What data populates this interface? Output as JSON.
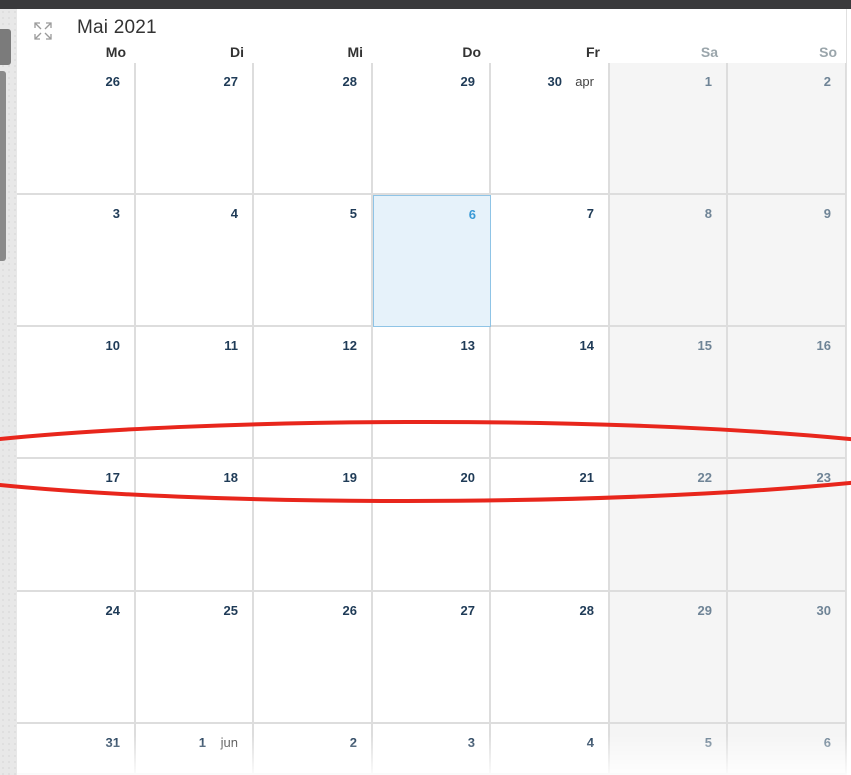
{
  "calendar": {
    "title": "Mai 2021",
    "weekdays": [
      "Mo",
      "Di",
      "Mi",
      "Do",
      "Fr",
      "Sa",
      "So"
    ],
    "weeks": [
      [
        {
          "day": "26",
          "label": ""
        },
        {
          "day": "27",
          "label": ""
        },
        {
          "day": "28",
          "label": ""
        },
        {
          "day": "29",
          "label": ""
        },
        {
          "day": "30",
          "label": "apr"
        },
        {
          "day": "1",
          "label": ""
        },
        {
          "day": "2",
          "label": ""
        }
      ],
      [
        {
          "day": "3",
          "label": ""
        },
        {
          "day": "4",
          "label": ""
        },
        {
          "day": "5",
          "label": ""
        },
        {
          "day": "6",
          "label": ""
        },
        {
          "day": "7",
          "label": ""
        },
        {
          "day": "8",
          "label": ""
        },
        {
          "day": "9",
          "label": ""
        }
      ],
      [
        {
          "day": "10",
          "label": ""
        },
        {
          "day": "11",
          "label": ""
        },
        {
          "day": "12",
          "label": ""
        },
        {
          "day": "13",
          "label": ""
        },
        {
          "day": "14",
          "label": ""
        },
        {
          "day": "15",
          "label": ""
        },
        {
          "day": "16",
          "label": ""
        }
      ],
      [
        {
          "day": "17",
          "label": ""
        },
        {
          "day": "18",
          "label": ""
        },
        {
          "day": "19",
          "label": ""
        },
        {
          "day": "20",
          "label": ""
        },
        {
          "day": "21",
          "label": ""
        },
        {
          "day": "22",
          "label": ""
        },
        {
          "day": "23",
          "label": ""
        }
      ],
      [
        {
          "day": "24",
          "label": ""
        },
        {
          "day": "25",
          "label": ""
        },
        {
          "day": "26",
          "label": ""
        },
        {
          "day": "27",
          "label": ""
        },
        {
          "day": "28",
          "label": ""
        },
        {
          "day": "29",
          "label": ""
        },
        {
          "day": "30",
          "label": ""
        }
      ],
      [
        {
          "day": "31",
          "label": ""
        },
        {
          "day": "1",
          "label": "jun"
        },
        {
          "day": "2",
          "label": ""
        },
        {
          "day": "3",
          "label": ""
        },
        {
          "day": "4",
          "label": ""
        },
        {
          "day": "5",
          "label": ""
        },
        {
          "day": "6",
          "label": ""
        }
      ]
    ],
    "today": "6",
    "icons": {
      "expand": "expand-icon"
    }
  },
  "colors": {
    "today_bg": "#e6f2fa",
    "today_text": "#3a9ad6",
    "annotation": "#e8261c"
  }
}
